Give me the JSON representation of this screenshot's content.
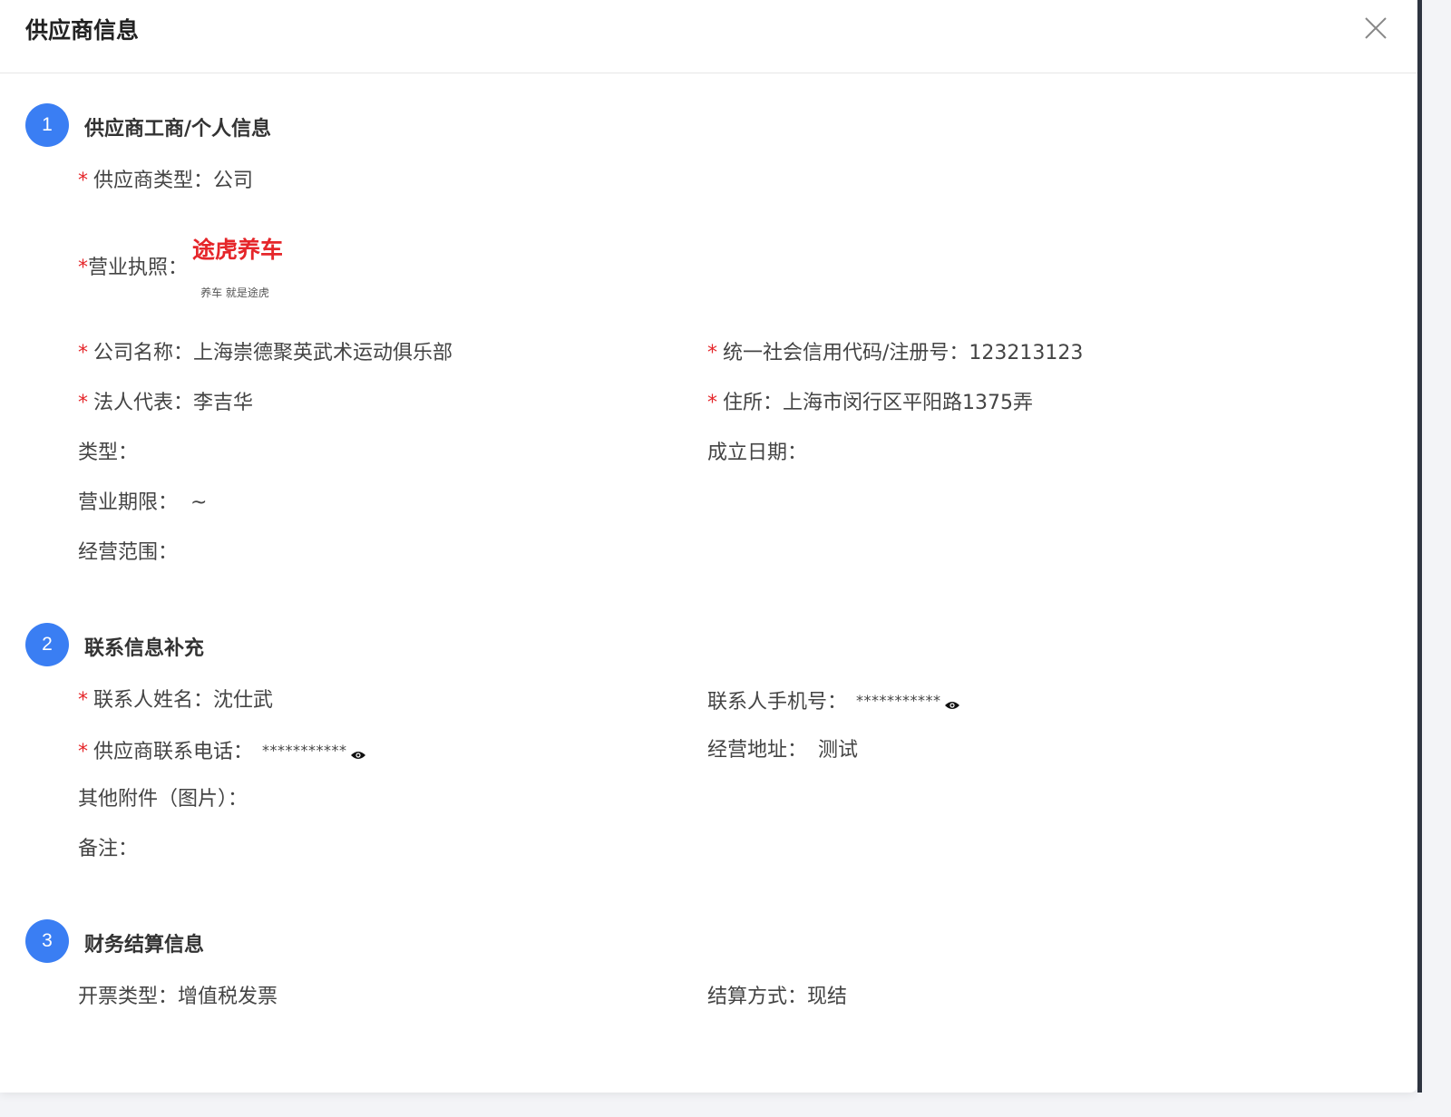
{
  "dialog": {
    "title": "供应商信息"
  },
  "sections": [
    {
      "number": "1",
      "title": "供应商工商/个人信息"
    },
    {
      "number": "2",
      "title": "联系信息补充"
    },
    {
      "number": "3",
      "title": "财务结算信息"
    }
  ],
  "business": {
    "supplier_type": {
      "label": "供应商类型：",
      "value": "公司"
    },
    "license": {
      "label": "营业执照："
    },
    "logo": {
      "main_text": "途虎养车",
      "slogan": "养车 就是途虎",
      "color": "#e5262a"
    },
    "company_name": {
      "label": "公司名称：",
      "value": "上海崇德聚英武术运动俱乐部"
    },
    "credit_code": {
      "label": "统一社会信用代码/注册号：",
      "value": "123213123"
    },
    "legal_rep": {
      "label": "法人代表：",
      "value": "李吉华"
    },
    "address": {
      "label": "住所：",
      "value": "上海市闵行区平阳路1375弄"
    },
    "type": {
      "label": "类型：",
      "value": ""
    },
    "established": {
      "label": "成立日期：",
      "value": ""
    },
    "period": {
      "label": "营业期限：",
      "value": "~"
    },
    "scope": {
      "label": "经营范围：",
      "value": ""
    }
  },
  "contact": {
    "name": {
      "label": "联系人姓名：",
      "value": "沈仕武"
    },
    "mobile": {
      "label": "联系人手机号：",
      "value": "***********"
    },
    "phone": {
      "label": "供应商联系电话：",
      "value": "***********"
    },
    "biz_address": {
      "label": "经营地址：",
      "value": "测试"
    },
    "attachments": {
      "label": "其他附件（图片）："
    },
    "remark": {
      "label": "备注：",
      "value": ""
    }
  },
  "finance": {
    "invoice_type": {
      "label": "开票类型：",
      "value": "增值税发票"
    },
    "settlement": {
      "label": "结算方式：",
      "value": "现结"
    }
  },
  "required_mark": "*",
  "accent_color": "#3a7ef3"
}
